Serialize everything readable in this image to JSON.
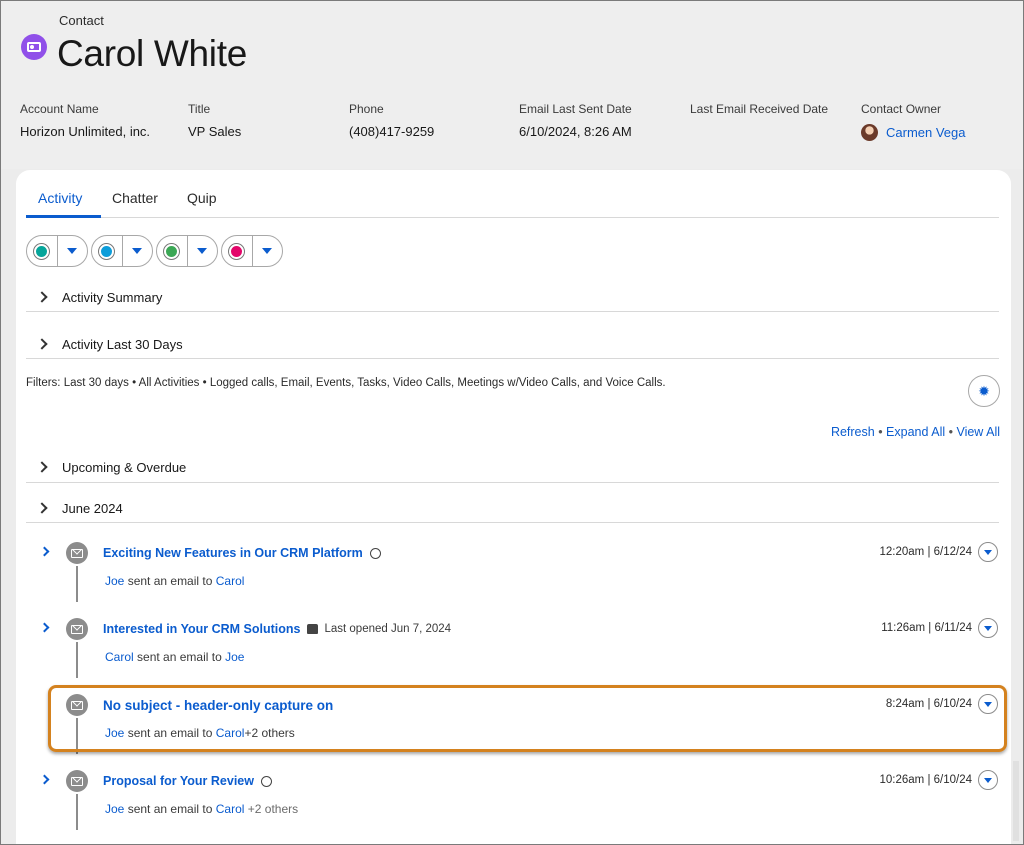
{
  "header": {
    "object_label": "Contact",
    "record_name": "Carol White",
    "fields": [
      {
        "label": "Account Name",
        "value": "Horizon Unlimited, inc."
      },
      {
        "label": "Title",
        "value": "VP Sales"
      },
      {
        "label": "Phone",
        "value": "(408)417-9259"
      },
      {
        "label": "Email Last Sent Date",
        "value": "6/10/2024, 8:26 AM"
      },
      {
        "label": "Last Email Received Date",
        "value": ""
      },
      {
        "label": "Contact Owner",
        "value": "Carmen Vega"
      }
    ]
  },
  "tabs": [
    {
      "label": "Activity",
      "active": true
    },
    {
      "label": "Chatter",
      "active": false
    },
    {
      "label": "Quip",
      "active": false
    }
  ],
  "action_buttons": [
    {
      "icon": "phone-call-icon",
      "color": "#06a59a"
    },
    {
      "icon": "email-icon",
      "color": "#0d9dda"
    },
    {
      "icon": "event-icon",
      "color": "#3ba755"
    },
    {
      "icon": "task-icon",
      "color": "#e3066a"
    }
  ],
  "sections": {
    "activity_summary": "Activity Summary",
    "activity_last_30": "Activity Last 30 Days",
    "upcoming": "Upcoming & Overdue",
    "june": "June 2024"
  },
  "filters_text": "Filters: Last 30 days • All Activities • Logged calls, Email, Events, Tasks, Video Calls, Meetings w/Video Calls, and Voice Calls.",
  "links": {
    "refresh": "Refresh",
    "sep": " • ",
    "expand_all": "Expand All",
    "view_all": "View All"
  },
  "timeline": [
    {
      "subject": "Exciting New Features in Our CRM Platform",
      "meta": "",
      "from": "Joe",
      "verb": " sent an email to ",
      "to": "Carol",
      "extra": "",
      "time": "12:20am | 6/12/24"
    },
    {
      "subject": "Interested in Your CRM Solutions",
      "meta": "Last opened Jun 7, 2024",
      "from": "Carol",
      "verb": " sent an email to ",
      "to": "Joe",
      "extra": "",
      "time": "11:26am | 6/11/24"
    },
    {
      "subject": "No subject - header-only capture on",
      "meta": "",
      "from": "Joe",
      "verb": " sent an email to ",
      "to": "Carol",
      "extra": "+2 others",
      "time": "8:24am | 6/10/24"
    },
    {
      "subject": "Proposal for Your Review",
      "meta": "",
      "from": "Joe",
      "verb": " sent an email to ",
      "to": "Carol",
      "extra": " +2 others",
      "time": "10:26am | 6/10/24"
    }
  ],
  "colors": {
    "link": "#0b5cce",
    "highlight_border": "#d4821f",
    "record_icon": "#9050e9"
  }
}
